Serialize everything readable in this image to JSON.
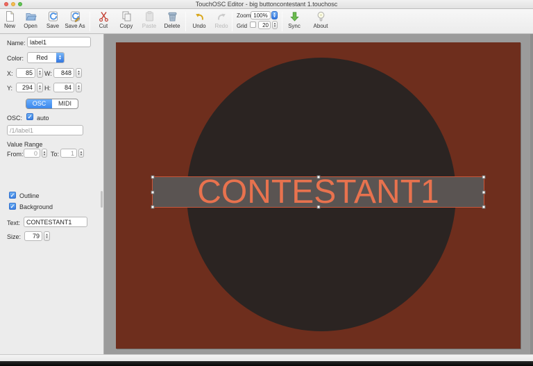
{
  "window": {
    "title": "TouchOSC Editor - big buttoncontestant 1.touchosc"
  },
  "toolbar": {
    "items": [
      {
        "id": "new",
        "label": "New",
        "enabled": true
      },
      {
        "id": "open",
        "label": "Open",
        "enabled": true
      },
      {
        "id": "save",
        "label": "Save",
        "enabled": true
      },
      {
        "id": "save-as",
        "label": "Save As",
        "enabled": true
      },
      {
        "id": "cut",
        "label": "Cut",
        "enabled": true
      },
      {
        "id": "copy",
        "label": "Copy",
        "enabled": true
      },
      {
        "id": "paste",
        "label": "Paste",
        "enabled": false
      },
      {
        "id": "delete",
        "label": "Delete",
        "enabled": true
      },
      {
        "id": "undo",
        "label": "Undo",
        "enabled": true
      },
      {
        "id": "redo",
        "label": "Redo",
        "enabled": false
      },
      {
        "id": "sync",
        "label": "Sync",
        "enabled": true
      },
      {
        "id": "about",
        "label": "About",
        "enabled": true
      }
    ],
    "zoom": {
      "label": "Zoom",
      "value": "100%"
    },
    "grid": {
      "label": "Grid",
      "checked": false,
      "value": "20"
    }
  },
  "inspector": {
    "name": {
      "label": "Name:",
      "value": "label1"
    },
    "color": {
      "label": "Color:",
      "value": "Red"
    },
    "x": {
      "label": "X:",
      "value": "85"
    },
    "w": {
      "label": "W:",
      "value": "848"
    },
    "y": {
      "label": "Y:",
      "value": "294"
    },
    "h": {
      "label": "H:",
      "value": "84"
    },
    "tabs": {
      "osc": "OSC",
      "midi": "MIDI",
      "active": "OSC"
    },
    "osc": {
      "label": "OSC:",
      "auto_label": "auto",
      "auto_checked": true,
      "address": "/1/label1"
    },
    "value_range": {
      "label": "Value Range",
      "from_label": "From:",
      "from_value": "0",
      "to_label": "To:",
      "to_value": "1"
    },
    "outline": {
      "label": "Outline",
      "checked": true
    },
    "background": {
      "label": "Background",
      "checked": true
    },
    "text": {
      "label": "Text:",
      "value": "CONTESTANT1"
    },
    "size": {
      "label": "Size:",
      "value": "79"
    }
  },
  "canvas": {
    "label_text": "CONTESTANT1",
    "colors": {
      "workspace": "#9b9b9b",
      "page": "#6e2e1d",
      "circle": "#2b2422",
      "label_bg": "#5a5452",
      "label_text": "#e8724e",
      "selection": "#c9583c"
    }
  }
}
